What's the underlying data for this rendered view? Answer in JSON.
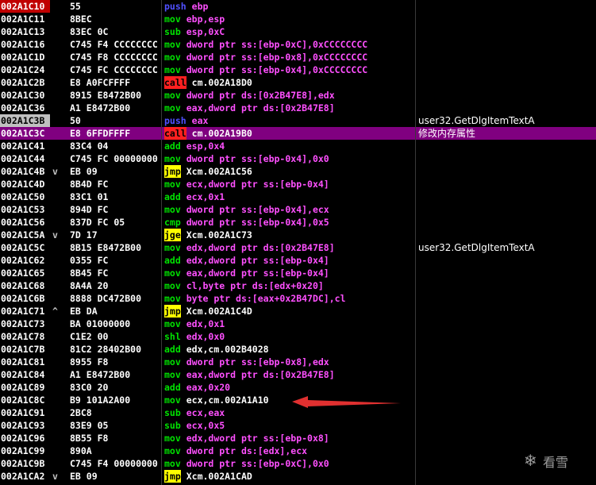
{
  "rows": [
    {
      "addr": "002A1C10",
      "mark": "",
      "hex": "55",
      "mn": "push",
      "ops": "ebp",
      "cmt": ""
    },
    {
      "addr": "002A1C11",
      "mark": "",
      "hex": "8BEC",
      "mn": "mov",
      "ops": "ebp,esp",
      "cmt": ""
    },
    {
      "addr": "002A1C13",
      "mark": "",
      "hex": "83EC 0C",
      "mn": "sub",
      "ops": "esp,0xC",
      "cmt": ""
    },
    {
      "addr": "002A1C16",
      "mark": "",
      "hex": "C745 F4 CCCCCCCC",
      "mn": "mov",
      "ops": "dword ptr ss:[ebp-0xC],0xCCCCCCCC",
      "cmt": ""
    },
    {
      "addr": "002A1C1D",
      "mark": "",
      "hex": "C745 F8 CCCCCCCC",
      "mn": "mov",
      "ops": "dword ptr ss:[ebp-0x8],0xCCCCCCCC",
      "cmt": ""
    },
    {
      "addr": "002A1C24",
      "mark": "",
      "hex": "C745 FC CCCCCCCC",
      "mn": "mov",
      "ops": "dword ptr ss:[ebp-0x4],0xCCCCCCCC",
      "cmt": ""
    },
    {
      "addr": "002A1C2B",
      "mark": "",
      "hex": "E8 A0FCFFFF",
      "mn": "call",
      "ops": "cm.002A18D0",
      "cmt": ""
    },
    {
      "addr": "002A1C30",
      "mark": "",
      "hex": "8915 E8472B00",
      "mn": "mov",
      "ops": "dword ptr ds:[0x2B47E8],edx",
      "cmt": ""
    },
    {
      "addr": "002A1C36",
      "mark": "",
      "hex": "A1 E8472B00",
      "mn": "mov",
      "ops": "eax,dword ptr ds:[0x2B47E8]",
      "cmt": ""
    },
    {
      "addr": "002A1C3B",
      "mark": "",
      "hex": "50",
      "mn": "push",
      "ops": "eax",
      "cmt": "user32.GetDlgItemTextA"
    },
    {
      "addr": "002A1C3C",
      "mark": "",
      "hex": "E8 6FFDFFFF",
      "mn": "call",
      "ops": "cm.002A19B0",
      "cmt": "修改内存属性"
    },
    {
      "addr": "002A1C41",
      "mark": "",
      "hex": "83C4 04",
      "mn": "add",
      "ops": "esp,0x4",
      "cmt": ""
    },
    {
      "addr": "002A1C44",
      "mark": "",
      "hex": "C745 FC 00000000",
      "mn": "mov",
      "ops": "dword ptr ss:[ebp-0x4],0x0",
      "cmt": ""
    },
    {
      "addr": "002A1C4B",
      "mark": "v",
      "hex": "EB 09",
      "mn": "jmp",
      "ops": "Xcm.002A1C56",
      "cmt": ""
    },
    {
      "addr": "002A1C4D",
      "mark": "",
      "hex": "8B4D FC",
      "mn": "mov",
      "ops": "ecx,dword ptr ss:[ebp-0x4]",
      "cmt": ""
    },
    {
      "addr": "002A1C50",
      "mark": "",
      "hex": "83C1 01",
      "mn": "add",
      "ops": "ecx,0x1",
      "cmt": ""
    },
    {
      "addr": "002A1C53",
      "mark": "",
      "hex": "894D FC",
      "mn": "mov",
      "ops": "dword ptr ss:[ebp-0x4],ecx",
      "cmt": ""
    },
    {
      "addr": "002A1C56",
      "mark": "",
      "hex": "837D FC 05",
      "mn": "cmp",
      "ops": "dword ptr ss:[ebp-0x4],0x5",
      "cmt": ""
    },
    {
      "addr": "002A1C5A",
      "mark": "v",
      "hex": "7D 17",
      "mn": "jge",
      "ops": "Xcm.002A1C73",
      "cmt": ""
    },
    {
      "addr": "002A1C5C",
      "mark": "",
      "hex": "8B15 E8472B00",
      "mn": "mov",
      "ops": "edx,dword ptr ds:[0x2B47E8]",
      "cmt": "user32.GetDlgItemTextA"
    },
    {
      "addr": "002A1C62",
      "mark": "",
      "hex": "0355 FC",
      "mn": "add",
      "ops": "edx,dword ptr ss:[ebp-0x4]",
      "cmt": ""
    },
    {
      "addr": "002A1C65",
      "mark": "",
      "hex": "8B45 FC",
      "mn": "mov",
      "ops": "eax,dword ptr ss:[ebp-0x4]",
      "cmt": ""
    },
    {
      "addr": "002A1C68",
      "mark": "",
      "hex": "8A4A 20",
      "mn": "mov",
      "ops": "cl,byte ptr ds:[edx+0x20]",
      "cmt": ""
    },
    {
      "addr": "002A1C6B",
      "mark": "",
      "hex": "8888 DC472B00",
      "mn": "mov",
      "ops": "byte ptr ds:[eax+0x2B47DC],cl",
      "cmt": ""
    },
    {
      "addr": "002A1C71",
      "mark": "^",
      "hex": "EB DA",
      "mn": "jmp",
      "ops": "Xcm.002A1C4D",
      "cmt": ""
    },
    {
      "addr": "002A1C73",
      "mark": "",
      "hex": "BA 01000000",
      "mn": "mov",
      "ops": "edx,0x1",
      "cmt": ""
    },
    {
      "addr": "002A1C78",
      "mark": "",
      "hex": "C1E2 00",
      "mn": "shl",
      "ops": "edx,0x0",
      "cmt": ""
    },
    {
      "addr": "002A1C7B",
      "mark": "",
      "hex": "81C2 28402B00",
      "mn": "add",
      "ops": "edx,cm.002B4028",
      "cmt": ""
    },
    {
      "addr": "002A1C81",
      "mark": "",
      "hex": "8955 F8",
      "mn": "mov",
      "ops": "dword ptr ss:[ebp-0x8],edx",
      "cmt": ""
    },
    {
      "addr": "002A1C84",
      "mark": "",
      "hex": "A1 E8472B00",
      "mn": "mov",
      "ops": "eax,dword ptr ds:[0x2B47E8]",
      "cmt": ""
    },
    {
      "addr": "002A1C89",
      "mark": "",
      "hex": "83C0 20",
      "mn": "add",
      "ops": "eax,0x20",
      "cmt": ""
    },
    {
      "addr": "002A1C8C",
      "mark": "",
      "hex": "B9 101A2A00",
      "mn": "mov",
      "ops": "ecx,cm.002A1A10",
      "cmt": ""
    },
    {
      "addr": "002A1C91",
      "mark": "",
      "hex": "2BC8",
      "mn": "sub",
      "ops": "ecx,eax",
      "cmt": ""
    },
    {
      "addr": "002A1C93",
      "mark": "",
      "hex": "83E9 05",
      "mn": "sub",
      "ops": "ecx,0x5",
      "cmt": ""
    },
    {
      "addr": "002A1C96",
      "mark": "",
      "hex": "8B55 F8",
      "mn": "mov",
      "ops": "edx,dword ptr ss:[ebp-0x8]",
      "cmt": ""
    },
    {
      "addr": "002A1C99",
      "mark": "",
      "hex": "890A",
      "mn": "mov",
      "ops": "dword ptr ds:[edx],ecx",
      "cmt": ""
    },
    {
      "addr": "002A1C9B",
      "mark": "",
      "hex": "C745 F4 00000000",
      "mn": "mov",
      "ops": "dword ptr ss:[ebp-0xC],0x0",
      "cmt": ""
    },
    {
      "addr": "002A1CA2",
      "mark": "v",
      "hex": "EB 09",
      "mn": "jmp",
      "ops": "Xcm.002A1CAD",
      "cmt": ""
    }
  ],
  "colors": {
    "background": "#000000",
    "selection": "#800080",
    "call_bg": "#ff2020",
    "jmp_bg": "#ffff00",
    "arrow": "#e03030"
  },
  "watermark": {
    "icon": "snowflake-icon",
    "text": "看雪"
  }
}
